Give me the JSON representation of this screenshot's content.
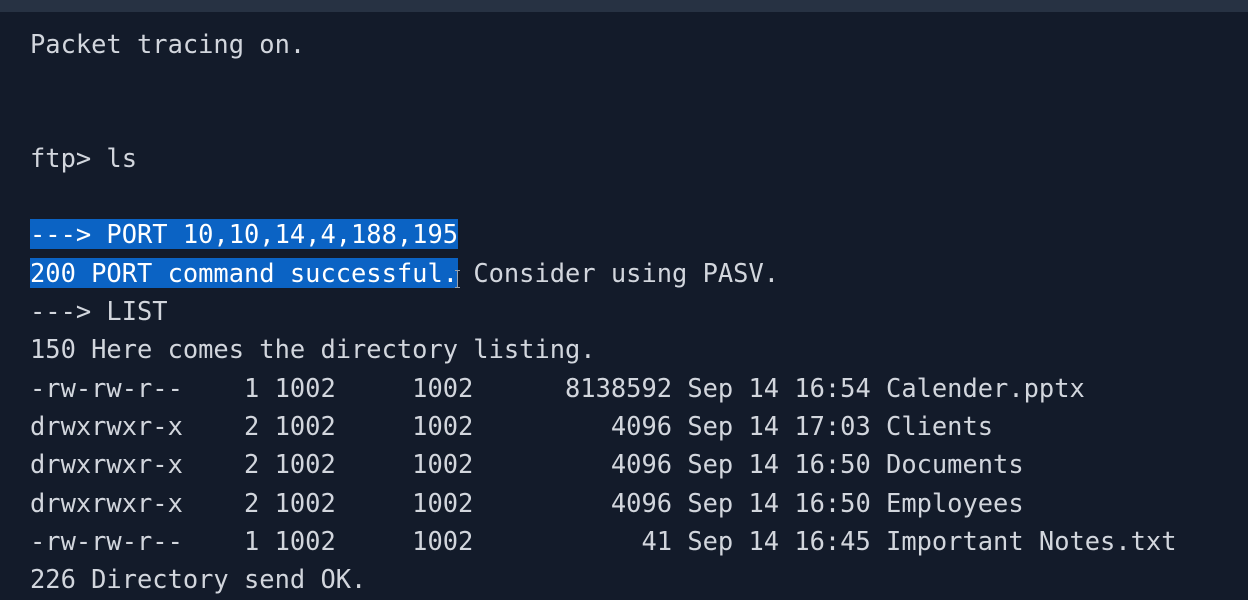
{
  "terminal": {
    "line_tracing": "Packet tracing on.",
    "line_prompt": "ftp> ls",
    "line_port_cmd": "---> PORT 10,10,14,4,188,195",
    "line_port_ok_selected": "200 PORT command successful.",
    "line_port_ok_rest": " Consider using PASV.",
    "line_list_cmd": "---> LIST",
    "line_150": "150 Here comes the directory listing.",
    "listing": [
      "-rw-rw-r--    1 1002     1002      8138592 Sep 14 16:54 Calender.pptx",
      "drwxrwxr-x    2 1002     1002         4096 Sep 14 17:03 Clients",
      "drwxrwxr-x    2 1002     1002         4096 Sep 14 16:50 Documents",
      "drwxrwxr-x    2 1002     1002         4096 Sep 14 16:50 Employees",
      "-rw-rw-r--    1 1002     1002           41 Sep 14 16:45 Important Notes.txt"
    ],
    "line_226": "226 Directory send OK."
  },
  "colors": {
    "background": "#131b2a",
    "text": "#d2d6dd",
    "selection": "#0b63c4",
    "topbar": "#273243"
  }
}
